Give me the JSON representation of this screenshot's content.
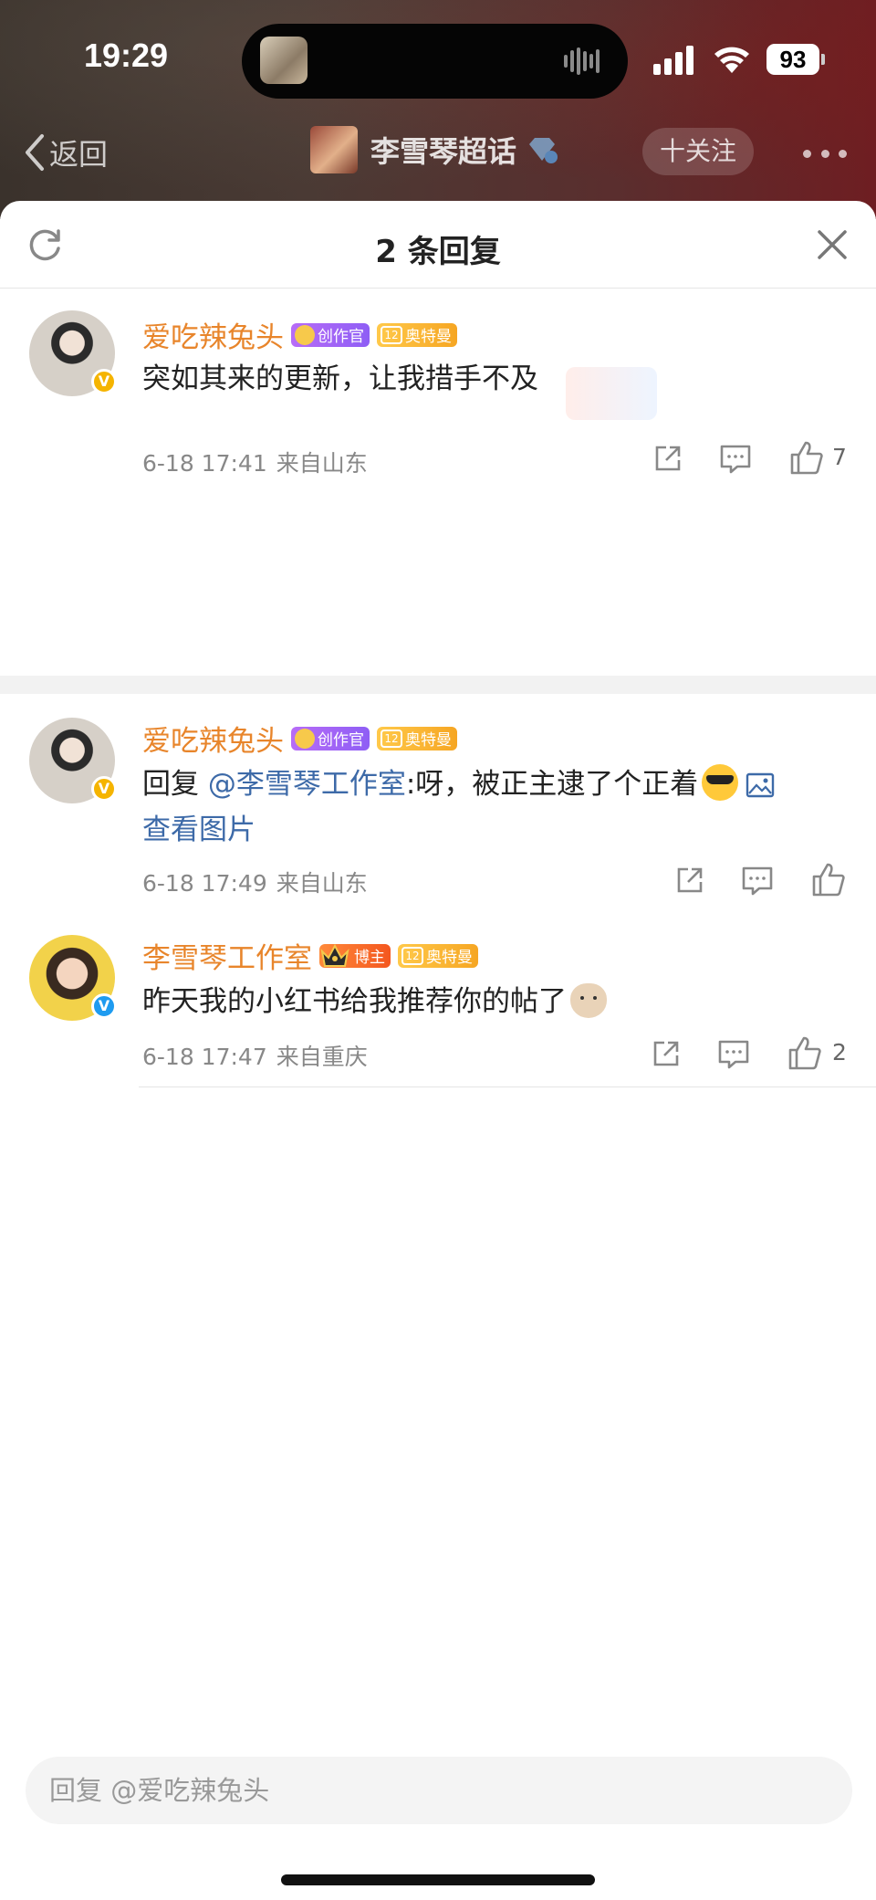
{
  "status_bar": {
    "time": "19:29",
    "battery": "93"
  },
  "nav": {
    "back_label": "返回",
    "topic_title": "李雪琴超话",
    "follow_label": "十关注"
  },
  "sheet": {
    "title": "2 条回复"
  },
  "comments": [
    {
      "username": "爱吃辣兔头",
      "tags": [
        "创作官",
        "奥特曼"
      ],
      "level": "12",
      "text": "突如其来的更新，让我措手不及",
      "date": "6-18 17:41",
      "location": "来自山东",
      "likes": "7"
    },
    {
      "username": "爱吃辣兔头",
      "tags": [
        "创作官",
        "奥特曼"
      ],
      "level": "12",
      "reply_prefix": "回复 ",
      "mention": "@李雪琴工作室",
      "text": ":呀，被正主逮了个正着",
      "view_picture": "查看图片",
      "date": "6-18 17:49",
      "location": "来自山东",
      "likes": ""
    },
    {
      "username": "李雪琴工作室",
      "tags": [
        "博主",
        "奥特曼"
      ],
      "level": "12",
      "text": "昨天我的小红书给我推荐你的帖了",
      "date": "6-18 17:47",
      "location": "来自重庆",
      "likes": "2"
    }
  ],
  "reply_input": {
    "placeholder": "回复 @爱吃辣兔头"
  },
  "icons": {
    "refresh": "refresh-icon",
    "close": "close-icon",
    "share": "share-icon",
    "comment": "comment-icon",
    "like": "thumbs-up-icon",
    "verified": "verified-icon"
  },
  "colors": {
    "username": "#e8852b",
    "mention": "#3d6aa8",
    "meta": "#888888",
    "verified_gold": "#f5b400",
    "verified_blue": "#1e9bf0"
  }
}
